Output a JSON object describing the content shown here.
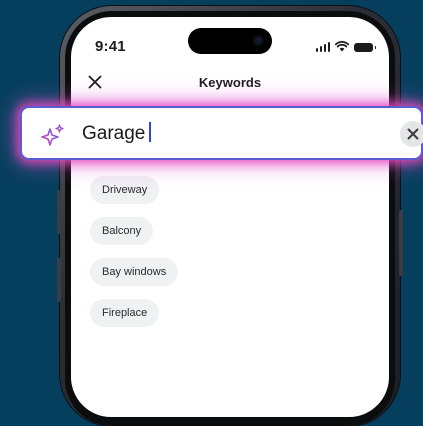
{
  "status": {
    "time": "9:41",
    "signal_icon": "cellular-signal-icon",
    "wifi_icon": "wifi-icon",
    "battery_icon": "battery-icon"
  },
  "nav": {
    "close_icon": "close-icon",
    "title": "Keywords"
  },
  "search": {
    "value": "Garage",
    "leading_icon": "sparkle-icon",
    "clear_icon": "clear-icon",
    "accent": "#5b5bd3",
    "glow": "#ec48be"
  },
  "keywords": [
    {
      "label": "Driveway"
    },
    {
      "label": "Balcony"
    },
    {
      "label": "Bay windows"
    },
    {
      "label": "Fireplace"
    }
  ],
  "colors": {
    "background": "#063f5e",
    "chip_bg": "#f0f1f3"
  }
}
